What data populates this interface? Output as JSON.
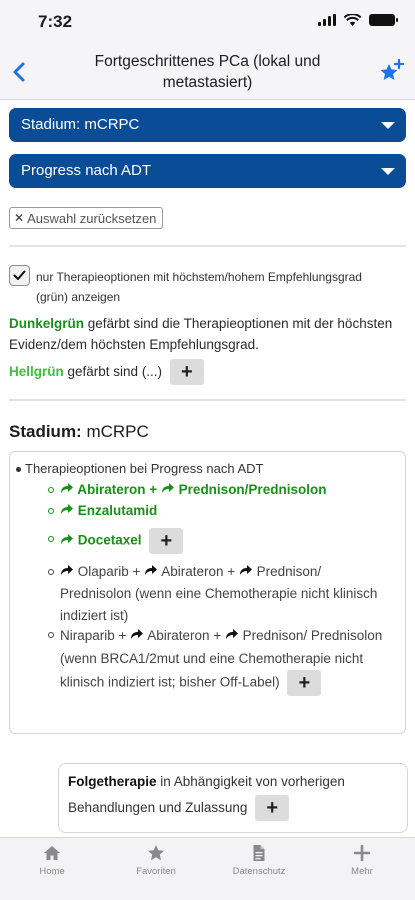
{
  "status": {
    "time": "7:32"
  },
  "nav": {
    "title": "Fortgeschrittenes PCa (lokal und metastasiert)"
  },
  "selects": {
    "stage": "Stadium: mCRPC",
    "situation": "Progress nach ADT"
  },
  "reset_label": "Auswahl zurücksetzen",
  "filter": {
    "checked": true,
    "label": "nur Therapieoptionen mit höchstem/hohem Empfehlungsgrad (grün) anzeigen"
  },
  "legend": {
    "dark_word": "Dunkelgrün",
    "dark_rest": " gefärbt sind die Therapieoptionen mit der höchsten Evidenz/dem höchsten Empfehlungsgrad.",
    "light_word": "Hellgrün",
    "light_rest": " gefärbt sind (...)"
  },
  "section": {
    "prefix": "Stadium:",
    "stage": "mCRPC"
  },
  "card": {
    "header": "Therapieoptionen bei Progress nach ADT",
    "item1": {
      "a": "Abirateron + ",
      "b": "Prednison/Prednisolon"
    },
    "item2": "Enzalutamid",
    "item3": "Docetaxel",
    "item4": {
      "a": "Olaparib + ",
      "b": "Abirateron + ",
      "c": "Prednison/ Prednisolon (wenn eine Chemotherapie nicht klinisch indiziert ist)"
    },
    "item5": {
      "a": "Niraparib + ",
      "b": "Abirateron + ",
      "c": "Prednison/ Prednisolon (wenn BRCA1/2mut und eine Chemotherapie nicht klinisch indiziert ist; bisher Off-Label)"
    }
  },
  "followup": {
    "bold": "Folgetherapie",
    "rest": " in Abhängigkeit von vorherigen Behandlungen und Zulassung"
  },
  "plus_symbol": "+",
  "tabs": {
    "home": "Home",
    "favorites": "Favoriten",
    "privacy": "Datenschutz",
    "more": "Mehr"
  },
  "colors": {
    "accent": "#0a4d96",
    "dark_green": "#1a8f1a",
    "light_green": "#3fbf3f",
    "link_blue": "#1a73e8"
  }
}
